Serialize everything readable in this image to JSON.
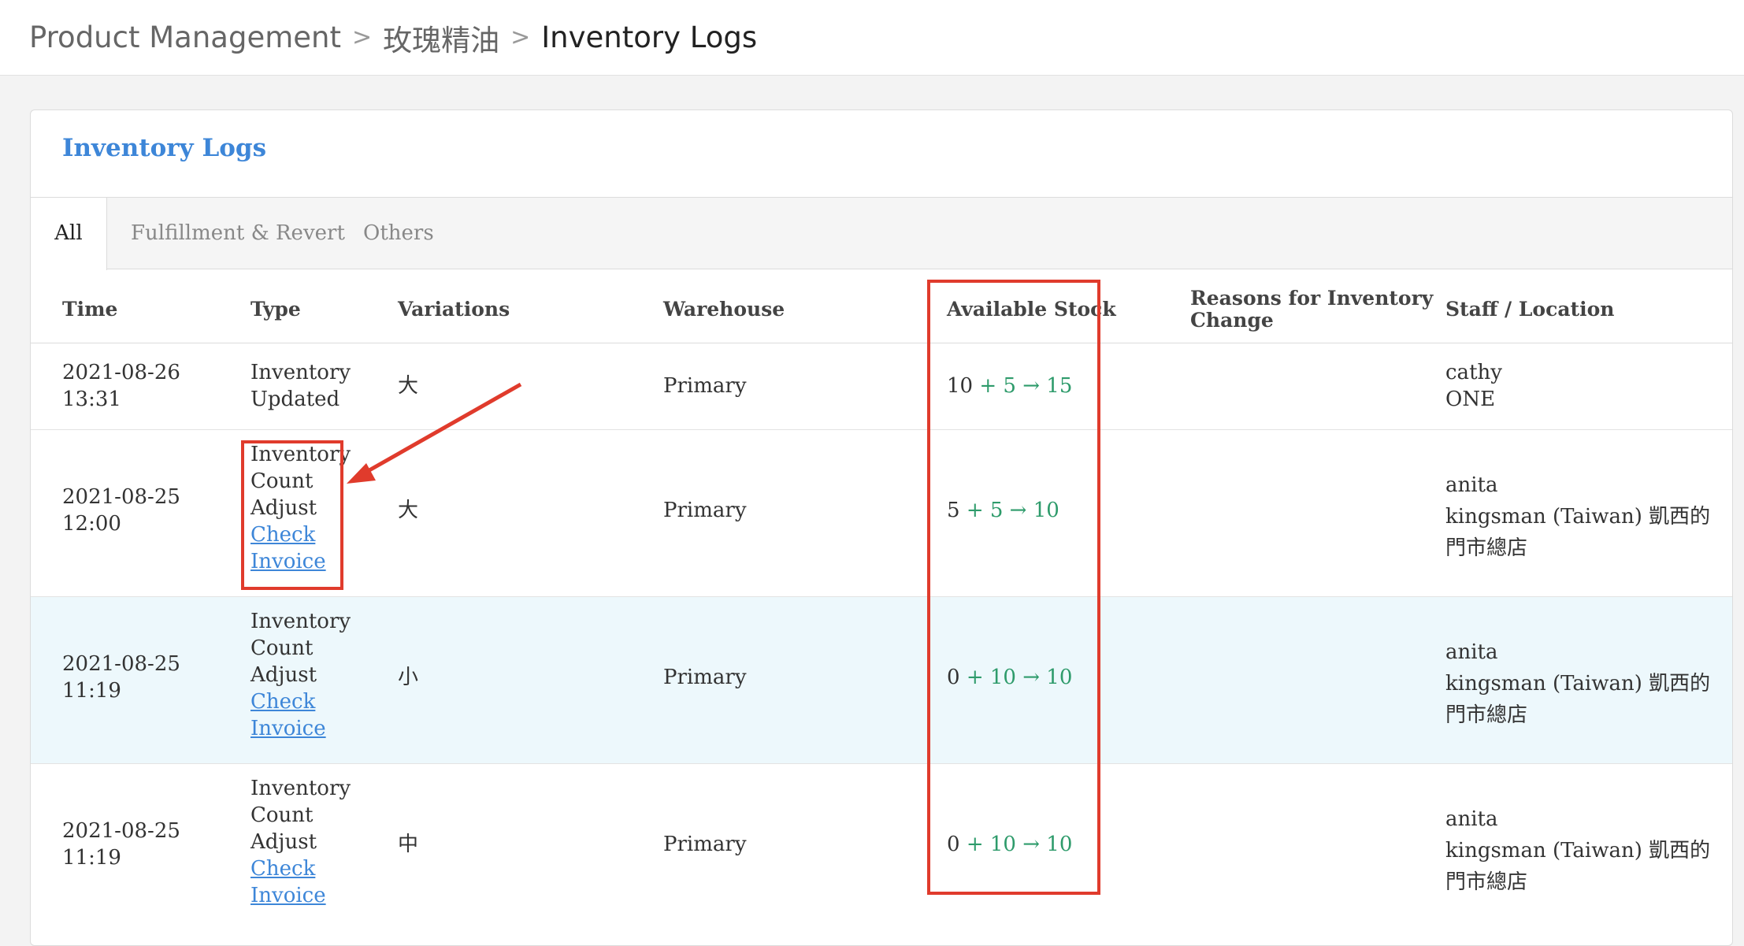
{
  "breadcrumb": {
    "items": [
      "Product Management",
      "玫瑰精油"
    ],
    "separator": ">",
    "current": "Inventory Logs"
  },
  "panel": {
    "title": "Inventory Logs"
  },
  "tabs": [
    {
      "label": "All",
      "active": true
    },
    {
      "label": "Fulfillment & Revert",
      "active": false
    },
    {
      "label": "Others",
      "active": false
    }
  ],
  "columns": {
    "time": "Time",
    "type": "Type",
    "variations": "Variations",
    "warehouse": "Warehouse",
    "stock": "Available Stock",
    "reasons_line1": "Reasons for Inventory",
    "reasons_line2": "Change",
    "staff": "Staff / Location"
  },
  "rows": [
    {
      "date": "2021-08-26",
      "time": "13:31",
      "type_lines": [
        "Inventory",
        "Updated"
      ],
      "links": [],
      "variation": "大",
      "warehouse": "Primary",
      "stock_old": "10",
      "stock_plus": "+ 5",
      "stock_arrow": "→",
      "stock_new": "15",
      "staff": "cathy",
      "location_lines": [
        "ONE"
      ]
    },
    {
      "date": "2021-08-25",
      "time": "12:00",
      "type_lines": [
        "Inventory",
        "Count",
        "Adjust"
      ],
      "links": [
        "Check",
        "Invoice"
      ],
      "variation": "大",
      "warehouse": "Primary",
      "stock_old": "5",
      "stock_plus": "+ 5",
      "stock_arrow": "→",
      "stock_new": "10",
      "staff": "anita",
      "location_lines": [
        "kingsman (Taiwan) 凱西的",
        "門市總店"
      ]
    },
    {
      "date": "2021-08-25",
      "time": "11:19",
      "type_lines": [
        "Inventory",
        "Count",
        "Adjust"
      ],
      "links": [
        "Check",
        "Invoice"
      ],
      "variation": "小",
      "warehouse": "Primary",
      "stock_old": "0",
      "stock_plus": "+ 10",
      "stock_arrow": "→",
      "stock_new": "10",
      "staff": "anita",
      "location_lines": [
        "kingsman (Taiwan) 凱西的",
        "門市總店"
      ]
    },
    {
      "date": "2021-08-25",
      "time": "11:19",
      "type_lines": [
        "Inventory",
        "Count",
        "Adjust"
      ],
      "links": [
        "Check",
        "Invoice"
      ],
      "variation": "中",
      "warehouse": "Primary",
      "stock_old": "0",
      "stock_plus": "+ 10",
      "stock_arrow": "→",
      "stock_new": "10",
      "staff": "anita",
      "location_lines": [
        "kingsman (Taiwan) 凱西的",
        "門市總店"
      ]
    }
  ],
  "colors": {
    "accent": "#3d86d8",
    "stock_change": "#2e9b6b",
    "annotation": "#e03b2c",
    "row_highlight": "#edf8fc"
  }
}
